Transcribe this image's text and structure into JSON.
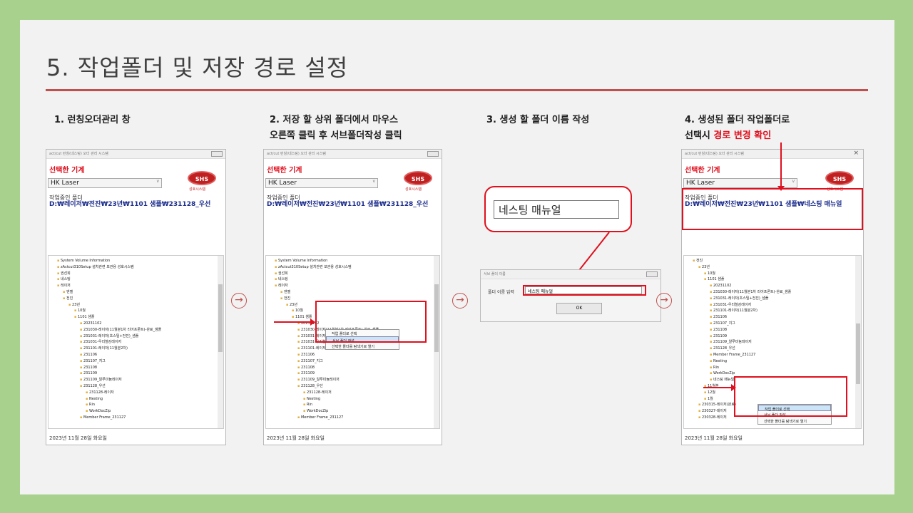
{
  "title": "5. 작업폴더 및 저장 경로 설정",
  "steps": {
    "s1": "1. 런칭오더관리 창",
    "s2a": "2. 저장 할 상위 폴더에서 마우스",
    "s2b": "오른쪽 클릭 후 서브폴더작성 클릭",
    "s3": "3. 생성 할 폴더 이름 작성",
    "s4a": "4. 생성된 폴더 작업폴더로",
    "s4b_pre": "선택시 ",
    "s4b_red": "경로 변경 확인"
  },
  "window": {
    "title": "act/cut 런칭(네스팅) 오더 관리 시스템",
    "selected_machine_label": "선택한 기계",
    "machine_value": "HK Laser",
    "logo": "SHS",
    "logo_sub": "성호시스템",
    "workfolder_label": "작업중인 폴더",
    "path1": "D:₩레이저₩전진₩23년₩1101 샘플₩231128_우선",
    "path4": "D:₩레이저₩전진₩23년₩1101 샘플₩네스팅 매뉴얼",
    "status": "2023년 11월 28일 화요일"
  },
  "tree1": [
    "System Volume Information",
    "zActcut310Setup 설치관련 보관용 성호시스템",
    "권선희",
    "네스팅",
    "레이저",
    "엔젤",
    "전진",
    "23년",
    "10월",
    "1101 샘플",
    "20231102",
    "231030-레이저(11월분1차 리어프론트)-완료_샘플",
    "231031-레이저(초스틸+전진)_샘플",
    "231031-우리철강레이저",
    "231101-레이저(11월분2차)",
    "231106",
    "231107_지그",
    "231108",
    "231109",
    "231109_알루미늄레이저",
    "231128_우선",
    "231128-레이저",
    "Nesting",
    "Rin",
    "WorkDocZip",
    "Member Frame_231127"
  ],
  "tree4": [
    "전진",
    "23년",
    "10월",
    "1101 샘플",
    "20231102",
    "231030-레이저(11월분1차 리어프론트)-완료_샘플",
    "231031-레이저(초스틸+전진)_샘플",
    "231031-우리철강레이저",
    "231101-레이저(11월분2차)",
    "231106",
    "231107_지그",
    "231108",
    "231109",
    "231109_알루미늄레이저",
    "231128_우선",
    "Member Frame_231127",
    "Nesting",
    "Rin",
    "WorkDocZip",
    "네스팅 매뉴얼",
    "11월분",
    "12월",
    "1월",
    "230315-레이저(완료)",
    "230327-레이저",
    "230328-레이저"
  ],
  "context_menu": [
    "작업 폴더로 선택",
    "서브 폴더 작성",
    "선택한 폴더를 탐색기로 열기"
  ],
  "dialog": {
    "title": "서브 폴더 이름",
    "label": "폴더 이름 입력",
    "value": "네스팅 매뉴얼",
    "ok": "OK",
    "callout_text": "네스팅 매뉴얼"
  },
  "arrow_glyph": "→",
  "accent_color": "#c0504d",
  "highlight_color": "#e0101e"
}
